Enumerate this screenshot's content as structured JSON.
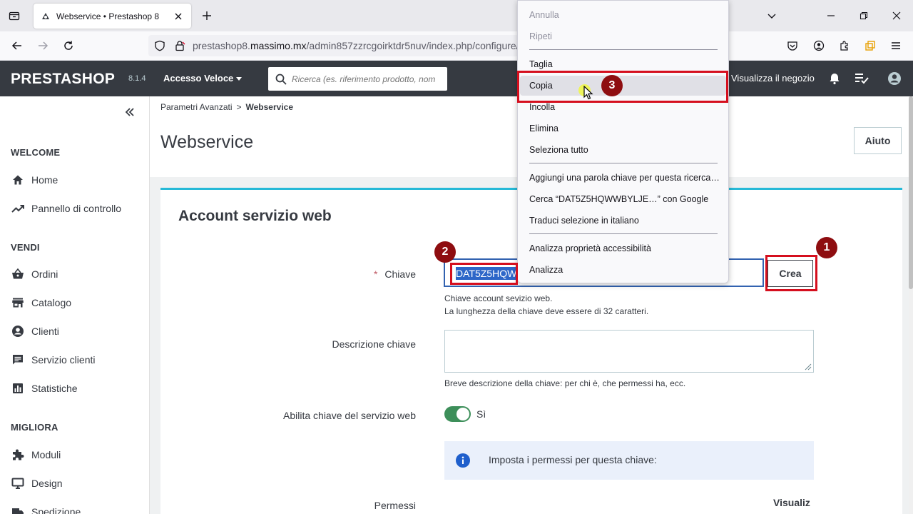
{
  "browser": {
    "tab_title": "Webservice • Prestashop 8",
    "url_prefix": "prestashop8.",
    "url_domain": "massimo.mx",
    "url_path": "/admin857zzrcgoirktdr5nuv/index.php/configure/"
  },
  "header": {
    "logo": "PRESTASHOP",
    "version": "8.1.4",
    "quick_access": "Accesso Veloce",
    "search_placeholder": "Ricerca (es. riferimento prodotto, nom",
    "visit_shop": "Visualizza il negozio"
  },
  "sidebar": {
    "sections": [
      {
        "title": "WELCOME",
        "items": [
          {
            "label": "Home",
            "icon": "home-icon"
          },
          {
            "label": "Pannello di controllo",
            "icon": "trending-up-icon"
          }
        ]
      },
      {
        "title": "VENDI",
        "items": [
          {
            "label": "Ordini",
            "icon": "basket-icon"
          },
          {
            "label": "Catalogo",
            "icon": "store-icon"
          },
          {
            "label": "Clienti",
            "icon": "account-circle-icon"
          },
          {
            "label": "Servizio clienti",
            "icon": "chat-icon"
          },
          {
            "label": "Statistiche",
            "icon": "bar-chart-icon"
          }
        ]
      },
      {
        "title": "MIGLIORA",
        "items": [
          {
            "label": "Moduli",
            "icon": "puzzle-icon"
          },
          {
            "label": "Design",
            "icon": "desktop-icon"
          },
          {
            "label": "Spedizione",
            "icon": "truck-icon"
          }
        ]
      }
    ]
  },
  "breadcrumb": {
    "parent": "Parametri Avanzati",
    "separator": ">",
    "current": "Webservice"
  },
  "page_title": "Webservice",
  "help_button": "Aiuto",
  "form": {
    "title": "Account servizio web",
    "key_label": "Chiave",
    "required_mark": "*",
    "key_value": "DAT5Z5HQW",
    "create_button": "Crea",
    "key_help_1": "Chiave account sevizio web.",
    "key_help_2": "La lunghezza della chiave deve essere di 32 caratteri.",
    "desc_label": "Descrizione chiave",
    "desc_help": "Breve descrizione della chiave: per chi è, che permessi ha, ecc.",
    "enable_label": "Abilita chiave del servizio web",
    "enable_value": "Sì",
    "enable_on": true,
    "info_text": "Imposta i permessi per questa chiave:",
    "permissions_label": "Permessi",
    "permissions_col": "Visualiz"
  },
  "context_menu": {
    "items": [
      {
        "label": "Annulla",
        "disabled": true
      },
      {
        "label": "Ripeti",
        "disabled": true
      },
      {
        "label": "Taglia",
        "disabled": false
      },
      {
        "label": "Copia",
        "disabled": false,
        "hover": true
      },
      {
        "label": "Incolla",
        "disabled": false
      },
      {
        "label": "Elimina",
        "disabled": false
      },
      {
        "label": "Seleziona tutto",
        "disabled": false
      },
      {
        "label": "Aggiungi una parola chiave per questa ricerca…",
        "disabled": false
      },
      {
        "label": "Cerca “DAT5Z5HQWWBYLJE…” con Google",
        "disabled": false
      },
      {
        "label": "Traduci selezione in italiano",
        "disabled": false
      },
      {
        "label": "Analizza proprietà accessibilità",
        "disabled": false
      },
      {
        "label": "Analizza",
        "disabled": false
      }
    ]
  },
  "annotations": {
    "step1": "1",
    "step2": "2",
    "step3": "3"
  },
  "colors": {
    "annotation_red": "#d50f1e",
    "annotation_badge": "#8e0d10",
    "ps_header": "#363a41",
    "accent": "#25b9d7",
    "switch_on": "#3d8f5a"
  }
}
